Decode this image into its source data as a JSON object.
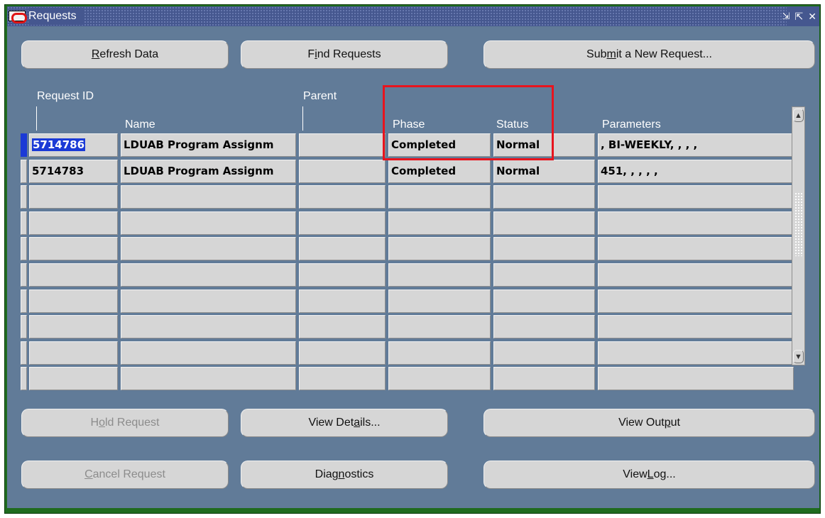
{
  "window": {
    "title": "Requests",
    "icons": {
      "app": "oracle-logo-icon",
      "minimize": "minimize-icon",
      "maximize": "maximize-icon",
      "close": "close-icon"
    },
    "controls": {
      "minimize_glyph": "⇲",
      "maximize_glyph": "⇱",
      "close_glyph": "✕"
    }
  },
  "toolbar": {
    "refresh": {
      "pre": "",
      "key": "R",
      "post": "efresh Data"
    },
    "find": {
      "pre": "F",
      "key": "i",
      "post": "nd Requests"
    },
    "submit": {
      "pre": "Sub",
      "key": "m",
      "post": "it a New Request..."
    }
  },
  "table": {
    "headers": {
      "request_id": "Request ID",
      "name": "Name",
      "parent": "Parent",
      "phase": "Phase",
      "status": "Status",
      "parameters": "Parameters"
    },
    "rows": [
      {
        "request_id": "5714786",
        "name": "LDUAB Program Assignm",
        "parent": "",
        "phase": "Completed",
        "status": "Normal",
        "parameters": ", BI-WEEKLY, , , ,"
      },
      {
        "request_id": "5714783",
        "name": "LDUAB Program Assignm",
        "parent": "",
        "phase": "Completed",
        "status": "Normal",
        "parameters": "451, , , , ,"
      },
      {
        "request_id": "",
        "name": "",
        "parent": "",
        "phase": "",
        "status": "",
        "parameters": ""
      },
      {
        "request_id": "",
        "name": "",
        "parent": "",
        "phase": "",
        "status": "",
        "parameters": ""
      },
      {
        "request_id": "",
        "name": "",
        "parent": "",
        "phase": "",
        "status": "",
        "parameters": ""
      },
      {
        "request_id": "",
        "name": "",
        "parent": "",
        "phase": "",
        "status": "",
        "parameters": ""
      },
      {
        "request_id": "",
        "name": "",
        "parent": "",
        "phase": "",
        "status": "",
        "parameters": ""
      },
      {
        "request_id": "",
        "name": "",
        "parent": "",
        "phase": "",
        "status": "",
        "parameters": ""
      },
      {
        "request_id": "",
        "name": "",
        "parent": "",
        "phase": "",
        "status": "",
        "parameters": ""
      },
      {
        "request_id": "",
        "name": "",
        "parent": "",
        "phase": "",
        "status": "",
        "parameters": ""
      }
    ]
  },
  "actions": {
    "hold": {
      "pre": "H",
      "key": "o",
      "post": "ld Request",
      "enabled": false
    },
    "view_details": {
      "pre": "View Det",
      "key": "a",
      "post": "ils...",
      "enabled": true
    },
    "view_output": {
      "pre": "View Out",
      "key": "p",
      "post": "ut",
      "enabled": true
    },
    "cancel": {
      "pre": "",
      "key": "C",
      "post": "ancel Request",
      "enabled": false
    },
    "diagnostics": {
      "pre": "Diag",
      "key": "n",
      "post": "ostics",
      "enabled": true
    },
    "view_log": {
      "pre": "View ",
      "key": "L",
      "post": "og...",
      "enabled": true
    }
  },
  "scrollbar": {
    "up_glyph": "▲",
    "down_glyph": "▼"
  },
  "colors": {
    "panel": "#617b98",
    "frame": "#1f6b1f",
    "titlebar": "#45578f",
    "field": "#d6d6d6",
    "selection": "#1b3ad6",
    "annotation_box": "#e8141e"
  }
}
